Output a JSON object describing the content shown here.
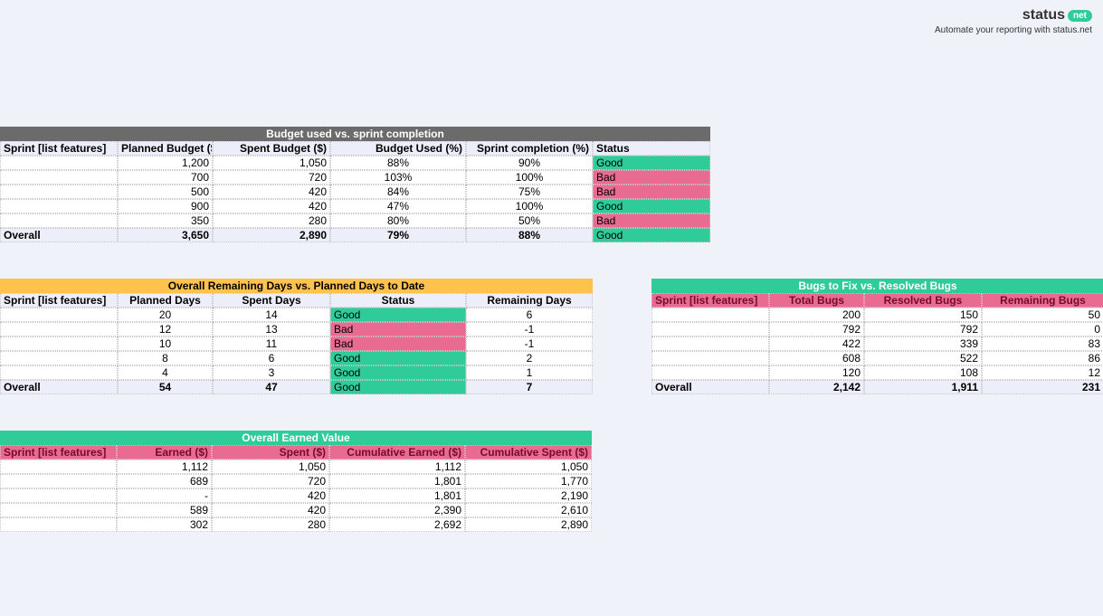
{
  "brand": {
    "name": "status",
    "badge": "net",
    "tagline": "Automate your reporting with status.net"
  },
  "t1": {
    "title": "Budget used vs. sprint completion",
    "cols": [
      "Sprint [list features]",
      "Planned Budget ($)",
      "Spent Budget ($)",
      "Budget Used (%)",
      "Sprint completion (%)",
      "Status"
    ],
    "rows": [
      {
        "s": "",
        "p": "1,200",
        "sp": "1,050",
        "bu": "88%",
        "sc": "90%",
        "st": "Good"
      },
      {
        "s": "",
        "p": "700",
        "sp": "720",
        "bu": "103%",
        "sc": "100%",
        "st": "Bad"
      },
      {
        "s": "",
        "p": "500",
        "sp": "420",
        "bu": "84%",
        "sc": "75%",
        "st": "Bad"
      },
      {
        "s": "",
        "p": "900",
        "sp": "420",
        "bu": "47%",
        "sc": "100%",
        "st": "Good"
      },
      {
        "s": "",
        "p": "350",
        "sp": "280",
        "bu": "80%",
        "sc": "50%",
        "st": "Bad"
      }
    ],
    "overall": {
      "s": "Overall",
      "p": "3,650",
      "sp": "2,890",
      "bu": "79%",
      "sc": "88%",
      "st": "Good"
    }
  },
  "t2": {
    "title": "Overall Remaining Days vs. Planned Days to Date",
    "cols": [
      "Sprint [list features]",
      "Planned Days",
      "Spent Days",
      "Status",
      "Remaining Days"
    ],
    "rows": [
      {
        "s": "",
        "pd": "20",
        "sd": "14",
        "st": "Good",
        "rd": "6"
      },
      {
        "s": "",
        "pd": "12",
        "sd": "13",
        "st": "Bad",
        "rd": "-1"
      },
      {
        "s": "",
        "pd": "10",
        "sd": "11",
        "st": "Bad",
        "rd": "-1"
      },
      {
        "s": "",
        "pd": "8",
        "sd": "6",
        "st": "Good",
        "rd": "2"
      },
      {
        "s": "",
        "pd": "4",
        "sd": "3",
        "st": "Good",
        "rd": "1"
      }
    ],
    "overall": {
      "s": "Overall",
      "pd": "54",
      "sd": "47",
      "st": "Good",
      "rd": "7"
    }
  },
  "t3": {
    "title": "Bugs to Fix vs. Resolved Bugs",
    "cols": [
      "Sprint [list features]",
      "Total Bugs",
      "Resolved Bugs",
      "Remaining Bugs"
    ],
    "rows": [
      {
        "s": "",
        "tb": "200",
        "rb": "150",
        "rm": "50"
      },
      {
        "s": "",
        "tb": "792",
        "rb": "792",
        "rm": "0"
      },
      {
        "s": "",
        "tb": "422",
        "rb": "339",
        "rm": "83"
      },
      {
        "s": "",
        "tb": "608",
        "rb": "522",
        "rm": "86"
      },
      {
        "s": "",
        "tb": "120",
        "rb": "108",
        "rm": "12"
      }
    ],
    "overall": {
      "s": "Overall",
      "tb": "2,142",
      "rb": "1,911",
      "rm": "231"
    }
  },
  "t4": {
    "title": "Overall Earned Value",
    "cols": [
      "Sprint [list features]",
      "Earned ($)",
      "Spent ($)",
      "Cumulative Earned ($)",
      "Cumulative Spent ($)"
    ],
    "rows": [
      {
        "s": "",
        "e": "1,112",
        "sp": "1,050",
        "ce": "1,112",
        "cs": "1,050"
      },
      {
        "s": "",
        "e": "689",
        "sp": "720",
        "ce": "1,801",
        "cs": "1,770"
      },
      {
        "s": "",
        "e": "-",
        "sp": "420",
        "ce": "1,801",
        "cs": "2,190"
      },
      {
        "s": "",
        "e": "589",
        "sp": "420",
        "ce": "2,390",
        "cs": "2,610"
      },
      {
        "s": "",
        "e": "302",
        "sp": "280",
        "ce": "2,692",
        "cs": "2,890"
      }
    ]
  }
}
